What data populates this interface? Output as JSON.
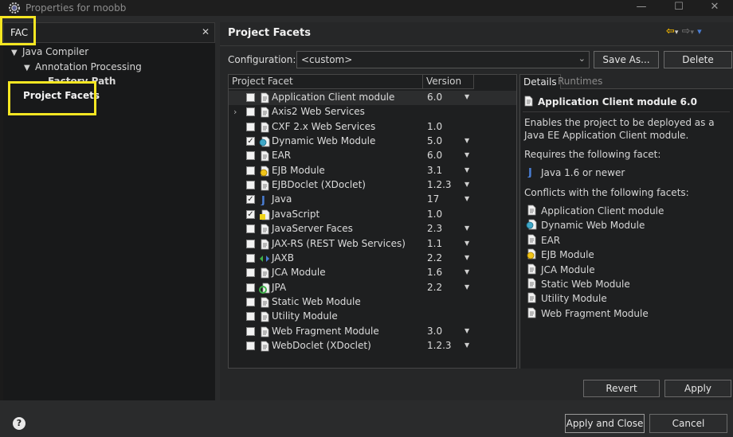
{
  "window": {
    "title": "Properties for moobb",
    "minimize": "—",
    "maximize": "☐",
    "close": "✕"
  },
  "filter": {
    "value": "FAC",
    "clear": "✕"
  },
  "tree": {
    "java_compiler": "Java Compiler",
    "annotation_processing": "Annotation Processing",
    "factory_path": "Factory Path",
    "project_facets": "Project Facets"
  },
  "header": {
    "title": "Project Facets",
    "back": "⇦",
    "forward": "⇨",
    "menu": "▾"
  },
  "configuration": {
    "label": "Configuration:",
    "value": "<custom>",
    "arrow": "⌄",
    "save_as": "Save As...",
    "delete": "Delete"
  },
  "facets_table": {
    "col_facet": "Project Facet",
    "col_version": "Version",
    "rows": [
      {
        "name": "Application Client module",
        "version": "6.0",
        "checked": false,
        "icon": "doc",
        "dropdown": true
      },
      {
        "name": "Axis2 Web Services",
        "version": "",
        "checked": false,
        "icon": "doc",
        "dropdown": false,
        "expandable": true
      },
      {
        "name": "CXF 2.x Web Services",
        "version": "1.0",
        "checked": false,
        "icon": "doc",
        "dropdown": false
      },
      {
        "name": "Dynamic Web Module",
        "version": "5.0",
        "checked": true,
        "icon": "web",
        "dropdown": true
      },
      {
        "name": "EAR",
        "version": "6.0",
        "checked": false,
        "icon": "doc",
        "dropdown": true
      },
      {
        "name": "EJB Module",
        "version": "3.1",
        "checked": false,
        "icon": "bean",
        "dropdown": true
      },
      {
        "name": "EJBDoclet (XDoclet)",
        "version": "1.2.3",
        "checked": false,
        "icon": "doc",
        "dropdown": true
      },
      {
        "name": "Java",
        "version": "17",
        "checked": true,
        "icon": "java",
        "dropdown": true
      },
      {
        "name": "JavaScript",
        "version": "1.0",
        "checked": true,
        "icon": "jsdoc",
        "dropdown": false
      },
      {
        "name": "JavaServer Faces",
        "version": "2.3",
        "checked": false,
        "icon": "doc",
        "dropdown": true
      },
      {
        "name": "JAX-RS (REST Web Services)",
        "version": "1.1",
        "checked": false,
        "icon": "doc",
        "dropdown": true
      },
      {
        "name": "JAXB",
        "version": "2.2",
        "checked": false,
        "icon": "jaxb",
        "dropdown": true
      },
      {
        "name": "JCA Module",
        "version": "1.6",
        "checked": false,
        "icon": "doc",
        "dropdown": true
      },
      {
        "name": "JPA",
        "version": "2.2",
        "checked": false,
        "icon": "jpa",
        "dropdown": true
      },
      {
        "name": "Static Web Module",
        "version": "",
        "checked": false,
        "icon": "doc",
        "dropdown": false
      },
      {
        "name": "Utility Module",
        "version": "",
        "checked": false,
        "icon": "doc",
        "dropdown": false
      },
      {
        "name": "Web Fragment Module",
        "version": "3.0",
        "checked": false,
        "icon": "doc",
        "dropdown": true
      },
      {
        "name": "WebDoclet (XDoclet)",
        "version": "1.2.3",
        "checked": false,
        "icon": "doc",
        "dropdown": true
      }
    ]
  },
  "details": {
    "tab_details": "Details",
    "tab_runtimes": "Runtimes",
    "heading": "Application Client module 6.0",
    "desc_line1": "Enables the project to be deployed as a",
    "desc_line2": "Java EE Application Client module.",
    "requires_label": "Requires the following facet:",
    "requires": [
      {
        "name": "Java 1.6 or newer",
        "icon": "java"
      }
    ],
    "conflicts_label": "Conflicts with the following facets:",
    "conflicts": [
      {
        "name": "Application Client module",
        "icon": "doc"
      },
      {
        "name": "Dynamic Web Module",
        "icon": "web"
      },
      {
        "name": "EAR",
        "icon": "doc"
      },
      {
        "name": "EJB Module",
        "icon": "bean"
      },
      {
        "name": "JCA Module",
        "icon": "doc"
      },
      {
        "name": "Static Web Module",
        "icon": "doc"
      },
      {
        "name": "Utility Module",
        "icon": "doc"
      },
      {
        "name": "Web Fragment Module",
        "icon": "doc"
      }
    ]
  },
  "buttons": {
    "revert": "Revert",
    "apply": "Apply",
    "apply_and_close": "Apply and Close",
    "cancel": "Cancel",
    "help": "?"
  },
  "colors": {
    "highlight": "#f5e622",
    "accent_arrow": "#f0b400",
    "menu_arrow": "#4a7fd6"
  }
}
